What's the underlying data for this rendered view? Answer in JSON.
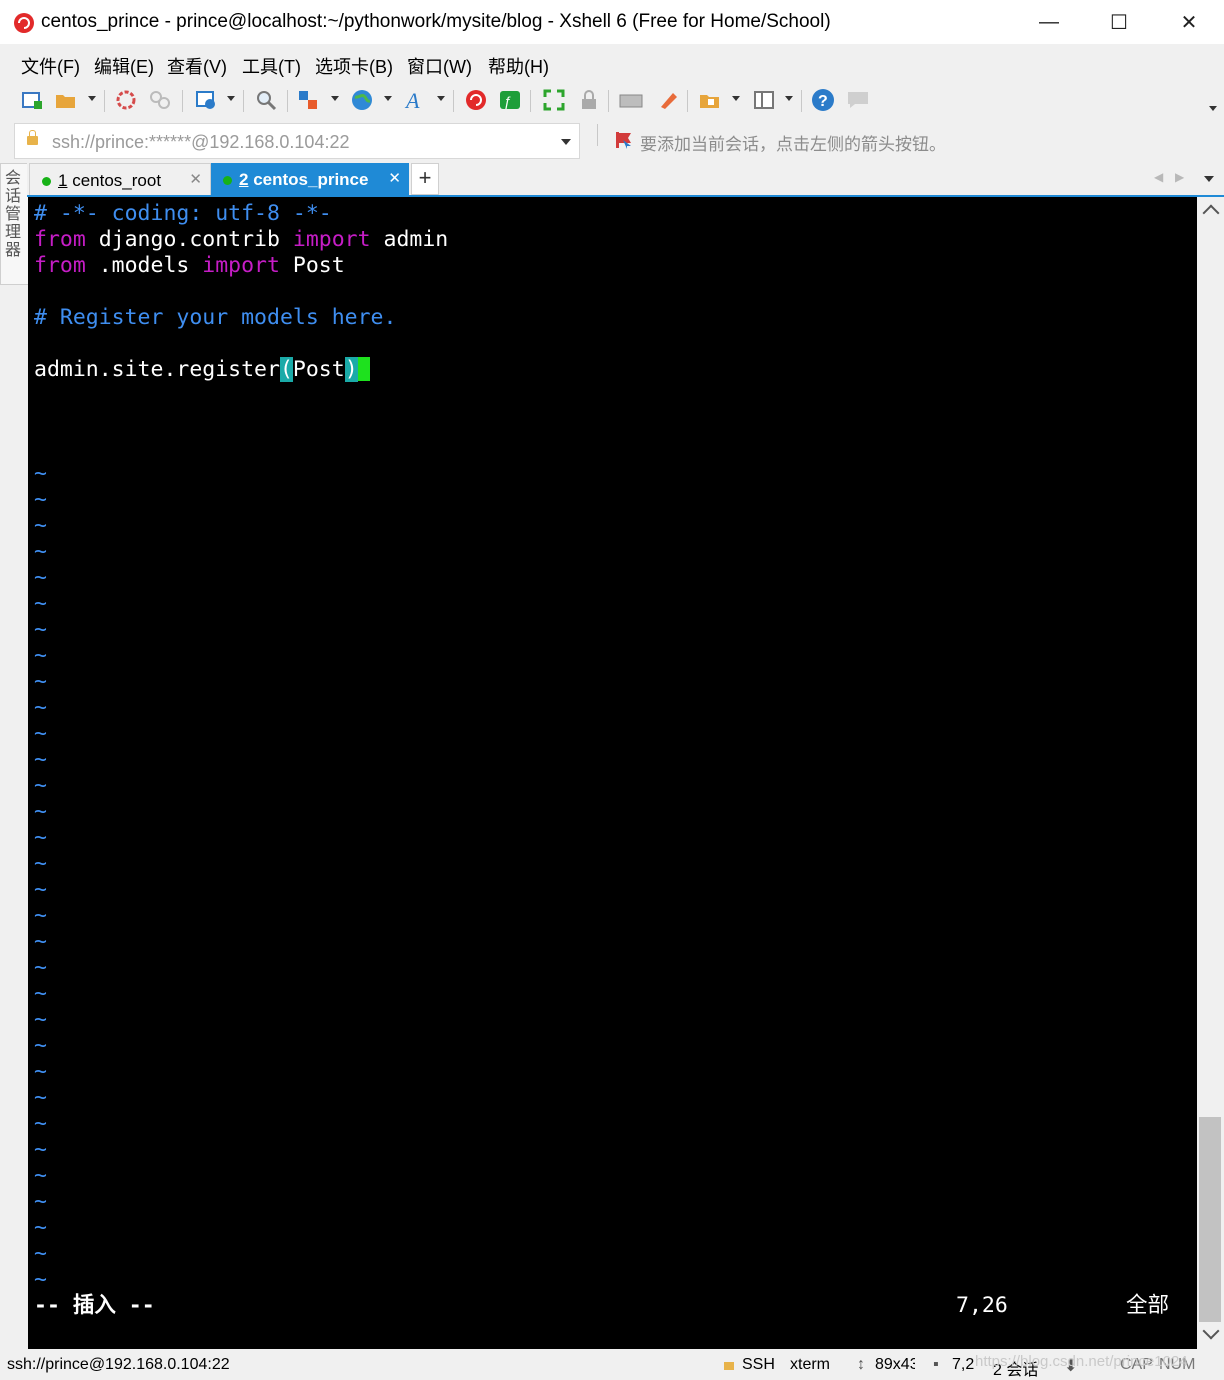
{
  "window": {
    "title": "centos_prince - prince@localhost:~/pythonwork/mysite/blog - Xshell 6 (Free for Home/School)",
    "minimize_glyph": "—",
    "maximize_glyph": "☐",
    "close_glyph": "✕"
  },
  "menu": [
    "文件(F)",
    "编辑(E)",
    "查看(V)",
    "工具(T)",
    "选项卡(B)",
    "窗口(W)",
    "帮助(H)"
  ],
  "toolbar": {
    "icons": [
      "new-session-icon",
      "open-folder-icon",
      "reconnect-icon",
      "disconnect-icon",
      "properties-icon",
      "find-icon",
      "transfer-icon",
      "globe-icon",
      "font-icon",
      "xshell-icon",
      "xftp-icon",
      "fullscreen-icon",
      "lock-icon",
      "keyboard-icon",
      "highlight-icon",
      "new-folder-icon",
      "layout-icon",
      "help-icon",
      "chat-icon"
    ]
  },
  "address": {
    "value": "ssh://prince:******@192.168.0.104:22",
    "hint": "要添加当前会话，点击左侧的箭头按钮。"
  },
  "side_panel": {
    "label": "会话管理器"
  },
  "tabs": [
    {
      "number": "1",
      "label": "centos_root",
      "active": false
    },
    {
      "number": "2",
      "label": "centos_prince",
      "active": true
    }
  ],
  "tab_add_label": "+",
  "terminal": {
    "line1": "# -*- coding: utf-8 -*-",
    "line2_kw1": "from",
    "line2_mod": " django.contrib ",
    "line2_kw2": "import",
    "line2_name": " admin",
    "line3_kw1": "from",
    "line3_mod": " .models ",
    "line3_kw2": "import",
    "line3_name": " Post",
    "line5": "# Register your models here.",
    "line7_pre": "admin.site.register",
    "line7_open": "(",
    "line7_arg": "Post",
    "line7_close": ")",
    "tilde": "~",
    "tilde_count": 32,
    "mode": "-- 插入 --",
    "position": "7,26",
    "scroll_pct": "全部"
  },
  "status": {
    "connection": "ssh://prince@192.168.0.104:22",
    "protocol": "SSH",
    "term": "xterm",
    "size": "89x43",
    "cursor": "7,2",
    "sessions": "2 会话",
    "caps": "CAP",
    "num": "NUM"
  },
  "watermark": "https://blog.csdn.net/prince1024"
}
